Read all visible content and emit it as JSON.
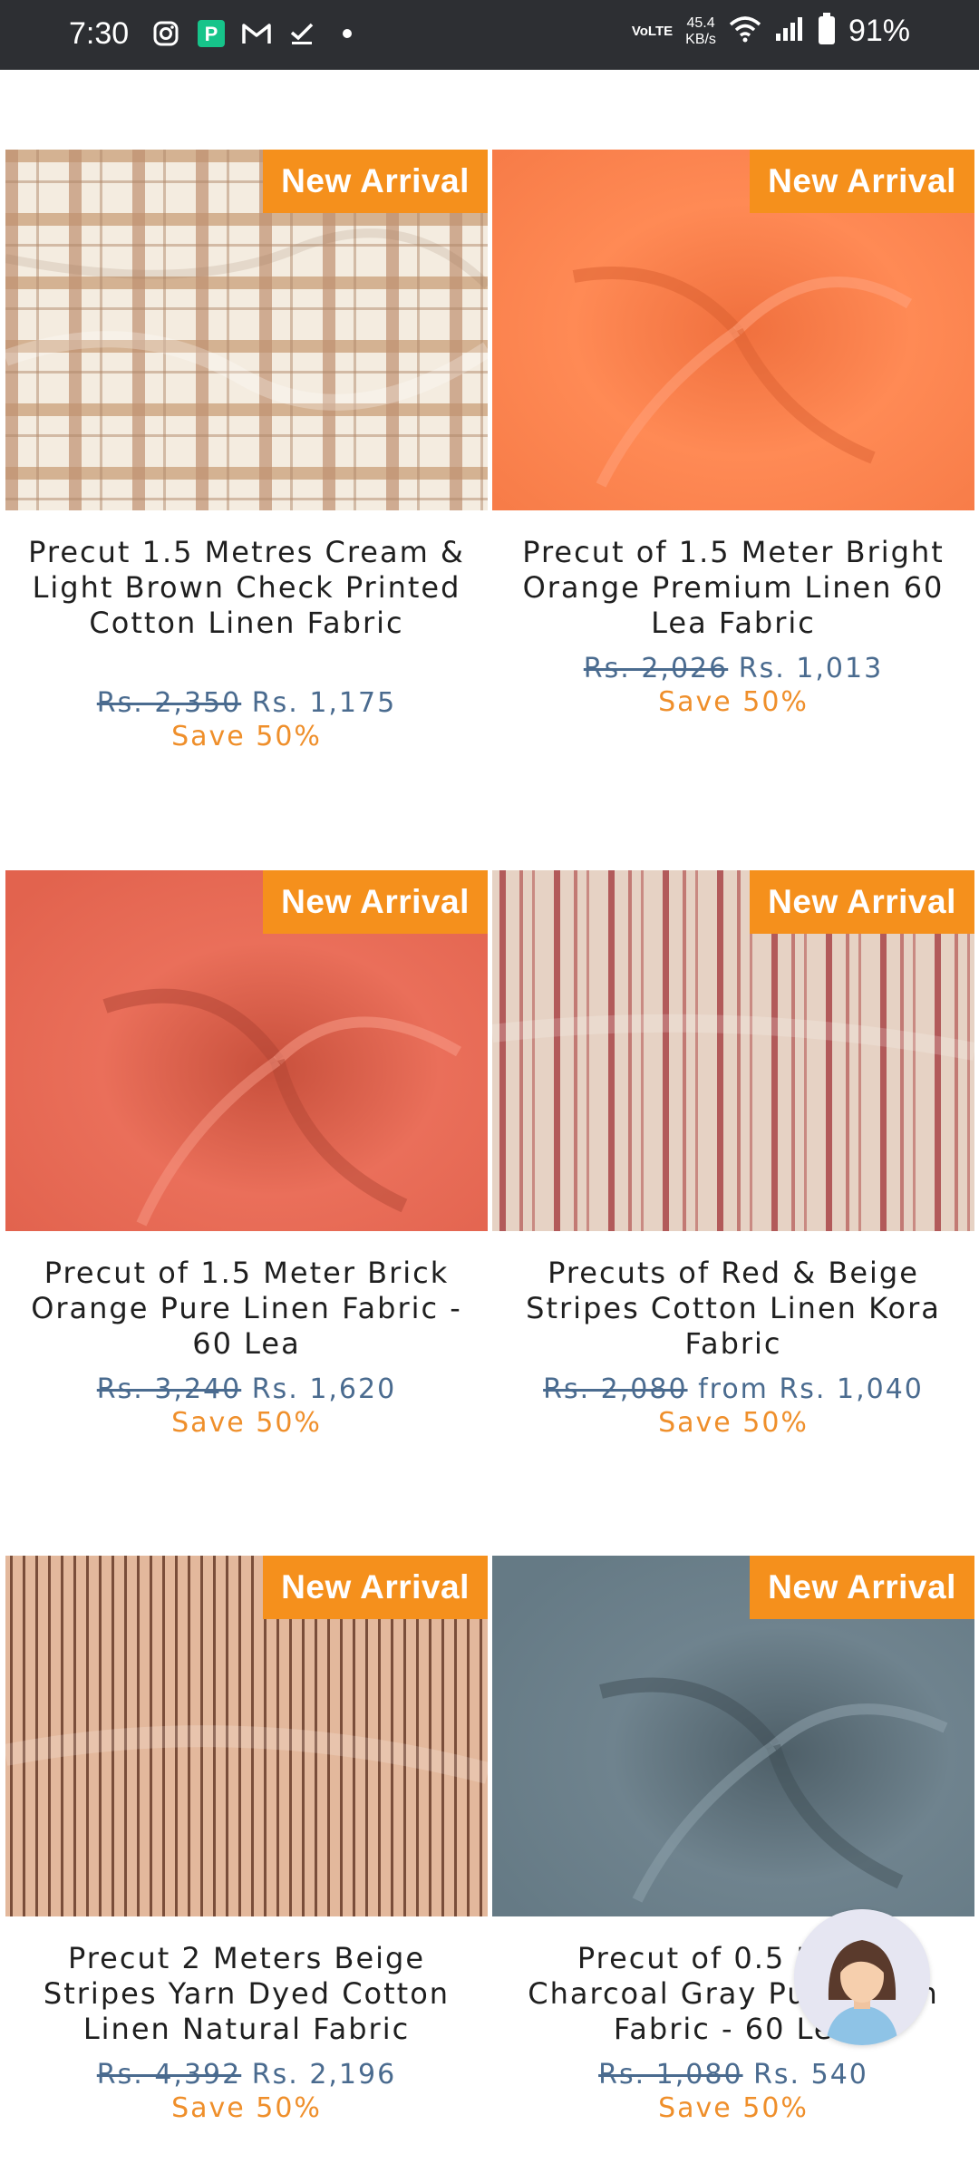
{
  "status_bar": {
    "time": "7:30",
    "network_label": "VoLTE",
    "speed_value": "45.4",
    "speed_unit": "KB/s",
    "battery_pct": "91%",
    "icons": [
      "instagram-icon",
      "paytm-icon",
      "gmail-icon",
      "tasks-icon",
      "dot-icon",
      "wifi-icon",
      "signal-icon",
      "battery-icon"
    ]
  },
  "products": [
    {
      "badge": "New Arrival",
      "title": "Precut 1.5 Metres Cream & Light Brown Check Printed Cotton Linen Fabric",
      "old_price": "Rs. 2,350",
      "price": "Rs. 1,175",
      "save": "Save 50%"
    },
    {
      "badge": "New Arrival",
      "title": "Precut of 1.5 Meter Bright Orange Premium Linen 60 Lea Fabric",
      "old_price": "Rs. 2,026",
      "price": "Rs. 1,013",
      "save": "Save 50%"
    },
    {
      "badge": "New Arrival",
      "title": "Precut of 1.5 Meter Brick Orange Pure Linen Fabric - 60 Lea",
      "old_price": "Rs. 3,240",
      "price": "Rs. 1,620",
      "save": "Save 50%"
    },
    {
      "badge": "New Arrival",
      "title": "Precuts of Red & Beige Stripes Cotton Linen Kora Fabric",
      "old_price": "Rs. 2,080",
      "price": "from Rs. 1,040",
      "save": "Save 50%"
    },
    {
      "badge": "New Arrival",
      "title": "Precut 2 Meters Beige Stripes Yarn Dyed Cotton Linen Natural Fabric",
      "old_price": "Rs. 4,392",
      "price": "Rs. 2,196",
      "save": "Save 50%"
    },
    {
      "badge": "New Arrival",
      "title": "Precut of 0.5 Meter Charcoal Gray Pure Linen Fabric - 60 Lea",
      "old_price": "Rs. 1,080",
      "price": "Rs. 540",
      "save": "Save 50%"
    }
  ],
  "colors": {
    "badge": "#f5901c",
    "price": "#4a6b8f",
    "save": "#ef8f2b",
    "status_bar": "#2d2f33"
  },
  "chat_widget_icon": "support-agent-avatar-icon"
}
